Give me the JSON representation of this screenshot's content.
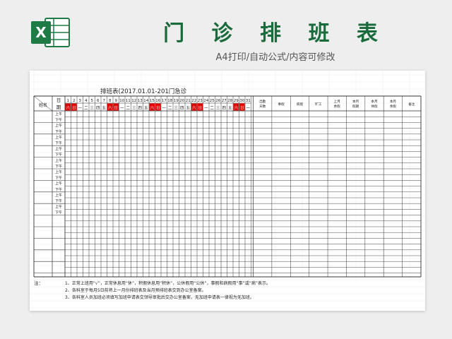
{
  "header": {
    "title": "门 诊 排 班 表",
    "subtitle": "A4打印/自动公式/内容可修改",
    "logo_letter": "X"
  },
  "sheet": {
    "table_title": "排班表(2017.01.01-201门急诊",
    "col_header_rijun_1": "日",
    "col_header_rijun_2": "期",
    "col_header_name": "姓名",
    "day_numbers": [
      "1",
      "2",
      "3",
      "4",
      "5",
      "6",
      "7",
      "8",
      "9",
      "10",
      "11",
      "12",
      "13",
      "14",
      "15",
      "16",
      "17",
      "18",
      "19",
      "20",
      "21",
      "22",
      "23",
      "24",
      "25",
      "26",
      "27",
      "28",
      "29",
      "30",
      "31"
    ],
    "weekdays": [
      "六",
      "日",
      "一",
      "二",
      "三",
      "四",
      "五",
      "六",
      "日",
      "一",
      "二",
      "三",
      "四",
      "五",
      "六",
      "日",
      "一",
      "二",
      "三",
      "四",
      "五",
      "六",
      "日",
      "一",
      "二",
      "三",
      "四",
      "五",
      "六",
      "日",
      "一"
    ],
    "weekend_color": "#e00000",
    "stat_headers": [
      "出勤天数",
      "事假",
      "病假",
      "旷工",
      "上月余假",
      "本月假期",
      "本月休假",
      "本月余假",
      "备注"
    ],
    "shift_labels": [
      "上午",
      "下午",
      "上午",
      "下午",
      "上午",
      "下午",
      "上午",
      "下午",
      "上午",
      "下午",
      "上午",
      "下午",
      "上午",
      "下午",
      "上午",
      "下午",
      "上午",
      "下午"
    ],
    "notes_label": "注：",
    "notes": [
      "1、正常上班用“√”，正常休息用“休”，积假休息用“积休”，公休假用“公休”，事假和病假用“事”或“病”表示。",
      "2、各科室于每月5日前将上一月份排班表及当月预排班表交到办公室备案。",
      "3、各科室人员加班必须填写加班申请表交领导审批后交办公室备案，无加班申请表一律视为无加班。"
    ]
  }
}
